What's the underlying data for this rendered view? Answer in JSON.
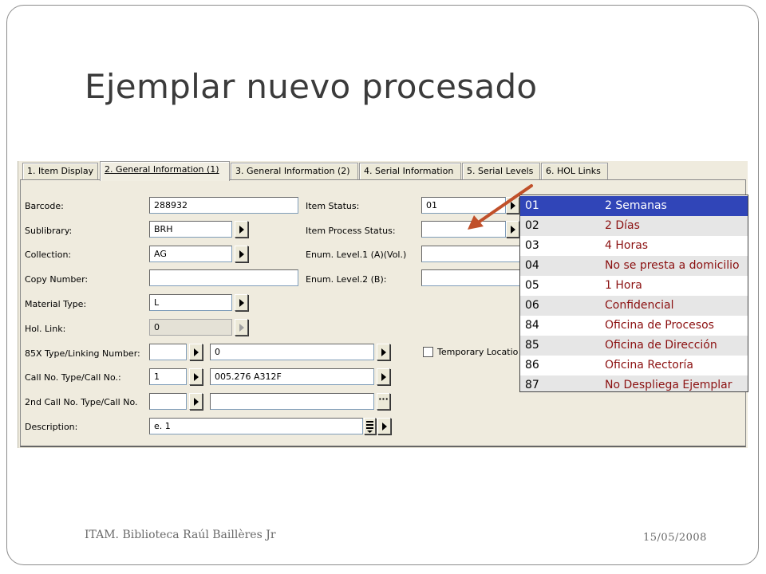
{
  "slide": {
    "title": "Ejemplar nuevo procesado",
    "footer_left": "ITAM. Biblioteca Raúl Baillères Jr",
    "footer_right": "15/05/2008"
  },
  "tabs": [
    {
      "label": "1. Item Display"
    },
    {
      "label": "2. General Information (1)",
      "active": true
    },
    {
      "label": "3. General Information (2)"
    },
    {
      "label": "4. Serial Information"
    },
    {
      "label": "5. Serial Levels"
    },
    {
      "label": "6. HOL Links"
    }
  ],
  "form": {
    "barcode_label": "Barcode:",
    "barcode_value": "288932",
    "sublibrary_label": "Sublibrary:",
    "sublibrary_value": "BRH",
    "collection_label": "Collection:",
    "collection_value": "AG",
    "copy_number_label": "Copy Number:",
    "copy_number_value": "",
    "material_type_label": "Material Type:",
    "material_type_value": "L",
    "hol_link_label": "Hol. Link:",
    "hol_link_value": "0",
    "type85x_label": "85X Type/Linking Number:",
    "type85x_value": "",
    "linking_number_value": "0",
    "call_no_label": "Call No. Type/Call No.:",
    "call_no_type_value": "1",
    "call_no_value": "005.276 A312F",
    "call_no2_label": "2nd Call No. Type/Call No.",
    "call_no2_type_value": "",
    "call_no2_value": "",
    "description_label": "Description:",
    "description_value": "e. 1",
    "item_status_label": "Item Status:",
    "item_status_value": "01",
    "item_process_status_label": "Item Process Status:",
    "item_process_status_value": "",
    "enum_level1_label": "Enum. Level.1 (A)(Vol.)",
    "enum_level1_value": "",
    "enum_level2_label": "Enum. Level.2  (B):",
    "enum_level2_value": "",
    "temporary_location_label": "Temporary Locatio"
  },
  "dropdown": {
    "options": [
      {
        "code": "01",
        "desc": "2 Semanas",
        "selected": true
      },
      {
        "code": "02",
        "desc": "2 Días"
      },
      {
        "code": "03",
        "desc": "4 Horas"
      },
      {
        "code": "04",
        "desc": "No se presta a domicilio"
      },
      {
        "code": "05",
        "desc": "1 Hora"
      },
      {
        "code": "06",
        "desc": "Confidencial"
      },
      {
        "code": "84",
        "desc": "Oficina de Procesos"
      },
      {
        "code": "85",
        "desc": "Oficina de Dirección"
      },
      {
        "code": "86",
        "desc": "Oficina Rectoría"
      },
      {
        "code": "87",
        "desc": "No Despliega Ejemplar"
      }
    ]
  },
  "colors": {
    "arrow": "#c0502a",
    "selected_bg": "#3045b8",
    "option_text": "#8b1010"
  },
  "icons": {
    "field_button": "triangle-right-icon",
    "ellipsis_button": "ellipsis-icon",
    "list_button": "list-icon",
    "pointer": "arrow-icon"
  }
}
